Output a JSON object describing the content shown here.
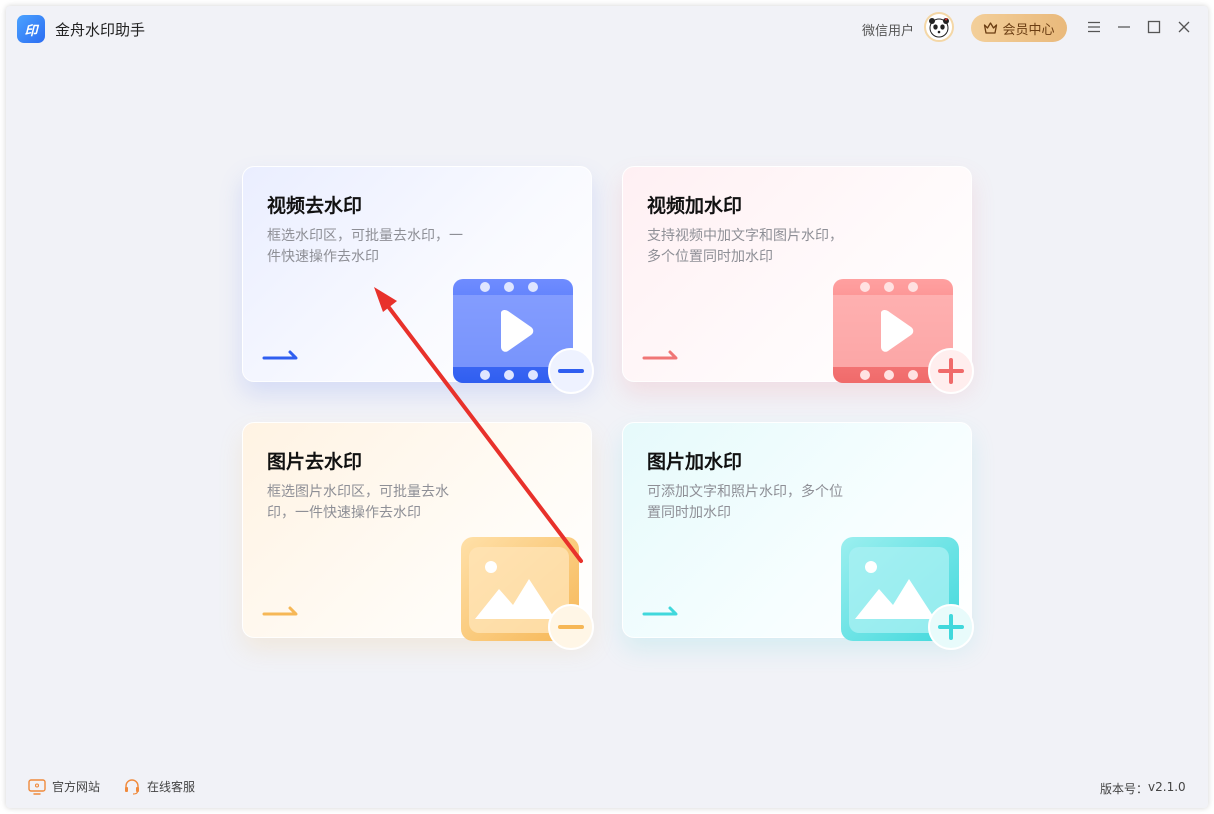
{
  "app": {
    "title": "金舟水印助手",
    "logo_text": "印"
  },
  "header": {
    "user_name": "微信用户",
    "vip_label": "会员中心"
  },
  "cards": [
    {
      "title": "视频去水印",
      "description": "框选水印区，可批量去水印，一件快速操作去水印",
      "accent": "#2f5ef0"
    },
    {
      "title": "视频加水印",
      "description": "支持视频中加文字和图片水印，多个位置同时加水印",
      "accent": "#f07676"
    },
    {
      "title": "图片去水印",
      "description": "框选图片水印区，可批量去水印，一件快速操作去水印",
      "accent": "#f6b756"
    },
    {
      "title": "图片加水印",
      "description": "可添加文字和照片水印，多个位置同时加水印",
      "accent": "#40d8dc"
    }
  ],
  "footer": {
    "website_label": "官方网站",
    "service_label": "在线客服",
    "version_label": "版本号：",
    "version_value": "v2.1.0"
  },
  "colors": {
    "annotation_arrow": "#e8312b"
  }
}
